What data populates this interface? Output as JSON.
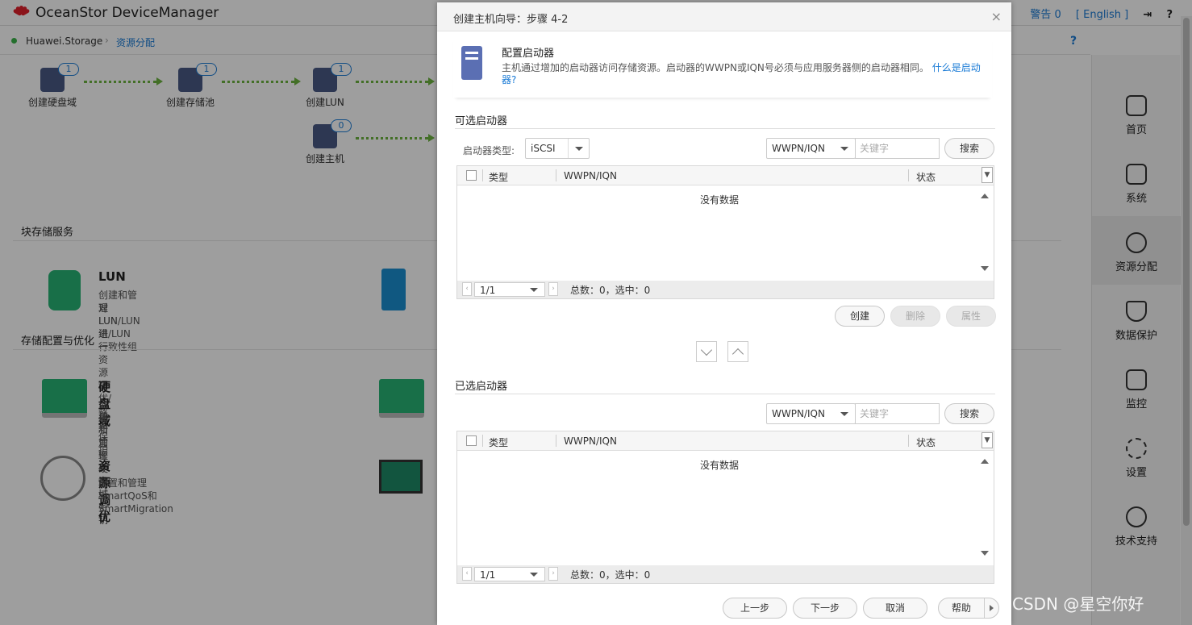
{
  "app": {
    "title": "OceanStor DeviceManager",
    "alarm": "警告 0",
    "language": "[ English ]"
  },
  "breadcrumb": {
    "device": "Huawei.Storage",
    "current": "资源分配"
  },
  "help": "?",
  "flow": [
    {
      "label": "创建硬盘域",
      "count": "1"
    },
    {
      "label": "创建存储池",
      "count": "1"
    },
    {
      "label": "创建LUN",
      "count": "1"
    },
    {
      "label": "创建主机",
      "count": "0"
    }
  ],
  "sections": {
    "block": "块存储服务",
    "config": "存储配置与优化"
  },
  "cards": {
    "lun": {
      "title": "LUN",
      "desc1": "创建和管理LUN/LUN组/LUN一致性组",
      "desc2": "对LUN进行资源调优/数据保护"
    },
    "diskdomain": {
      "title": "硬盘域",
      "desc1": "创建和管理硬盘域",
      "desc2": "更新加密硬盘域密钥"
    },
    "tuning": {
      "title": "资源调优",
      "desc1": "配置和管理SmartQoS和SmartMigration"
    }
  },
  "nav": [
    {
      "label": "首页"
    },
    {
      "label": "系统"
    },
    {
      "label": "资源分配"
    },
    {
      "label": "数据保护"
    },
    {
      "label": "监控"
    },
    {
      "label": "设置"
    },
    {
      "label": "技术支持"
    }
  ],
  "dialog": {
    "title": "创建主机向导：步骤 4-2",
    "close": "×",
    "intro_title": "配置启动器",
    "intro_text": "主机通过增加的启动器访问存储资源。启动器的WWPN或IQN号必须与应用服务器侧的启动器相同。",
    "intro_link": "什么是启动器?",
    "available": {
      "title": "可选启动器",
      "type_label": "启动器类型:",
      "type_value": "iSCSI",
      "filter_value": "WWPN/IQN",
      "keyword_placeholder": "关键字",
      "search": "搜索",
      "columns": [
        "类型",
        "WWPN/IQN",
        "状态"
      ],
      "empty": "没有数据",
      "page": "1/1",
      "total": "总数：0，选中：0",
      "create": "创建",
      "delete": "删除",
      "properties": "属性"
    },
    "selected": {
      "title": "已选启动器",
      "filter_value": "WWPN/IQN",
      "keyword_placeholder": "关键字",
      "search": "搜索",
      "columns": [
        "类型",
        "WWPN/IQN",
        "状态"
      ],
      "empty": "没有数据",
      "page": "1/1",
      "total": "总数：0，选中：0"
    },
    "footer": {
      "prev": "上一步",
      "next": "下一步",
      "cancel": "取消",
      "help": "帮助"
    }
  },
  "watermark": "CSDN @星空你好"
}
